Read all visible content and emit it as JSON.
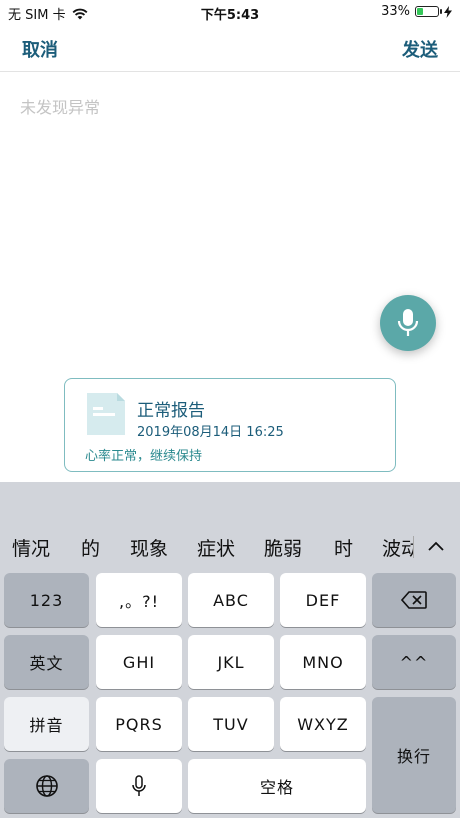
{
  "status_bar": {
    "carrier": "无 SIM 卡",
    "time": "下午5:43",
    "battery_percent": "33%",
    "battery_level": 0.33
  },
  "nav": {
    "cancel_label": "取消",
    "send_label": "发送"
  },
  "editor": {
    "placeholder": "未发现异常"
  },
  "report_card": {
    "title": "正常报告",
    "datetime": "2019年08月14日 16:25",
    "description": "心率正常，继续保持"
  },
  "keyboard": {
    "candidates": [
      "情况",
      "的",
      "现象",
      "症状",
      "脆弱",
      "时",
      "波动"
    ],
    "keys": {
      "num": "123",
      "punct": ",。?!",
      "abc": "ABC",
      "def": "DEF",
      "english": "英文",
      "ghi": "GHI",
      "jkl": "JKL",
      "mno": "MNO",
      "emoticon": "^^",
      "pinyin": "拼音",
      "pqrs": "PQRS",
      "tuv": "TUV",
      "wxyz": "WXYZ",
      "return": "换行",
      "space": "空格"
    }
  },
  "colors": {
    "accent": "#1c5d7a",
    "teal": "#5ba8a8",
    "keyboard_bg": "#d1d4da"
  }
}
